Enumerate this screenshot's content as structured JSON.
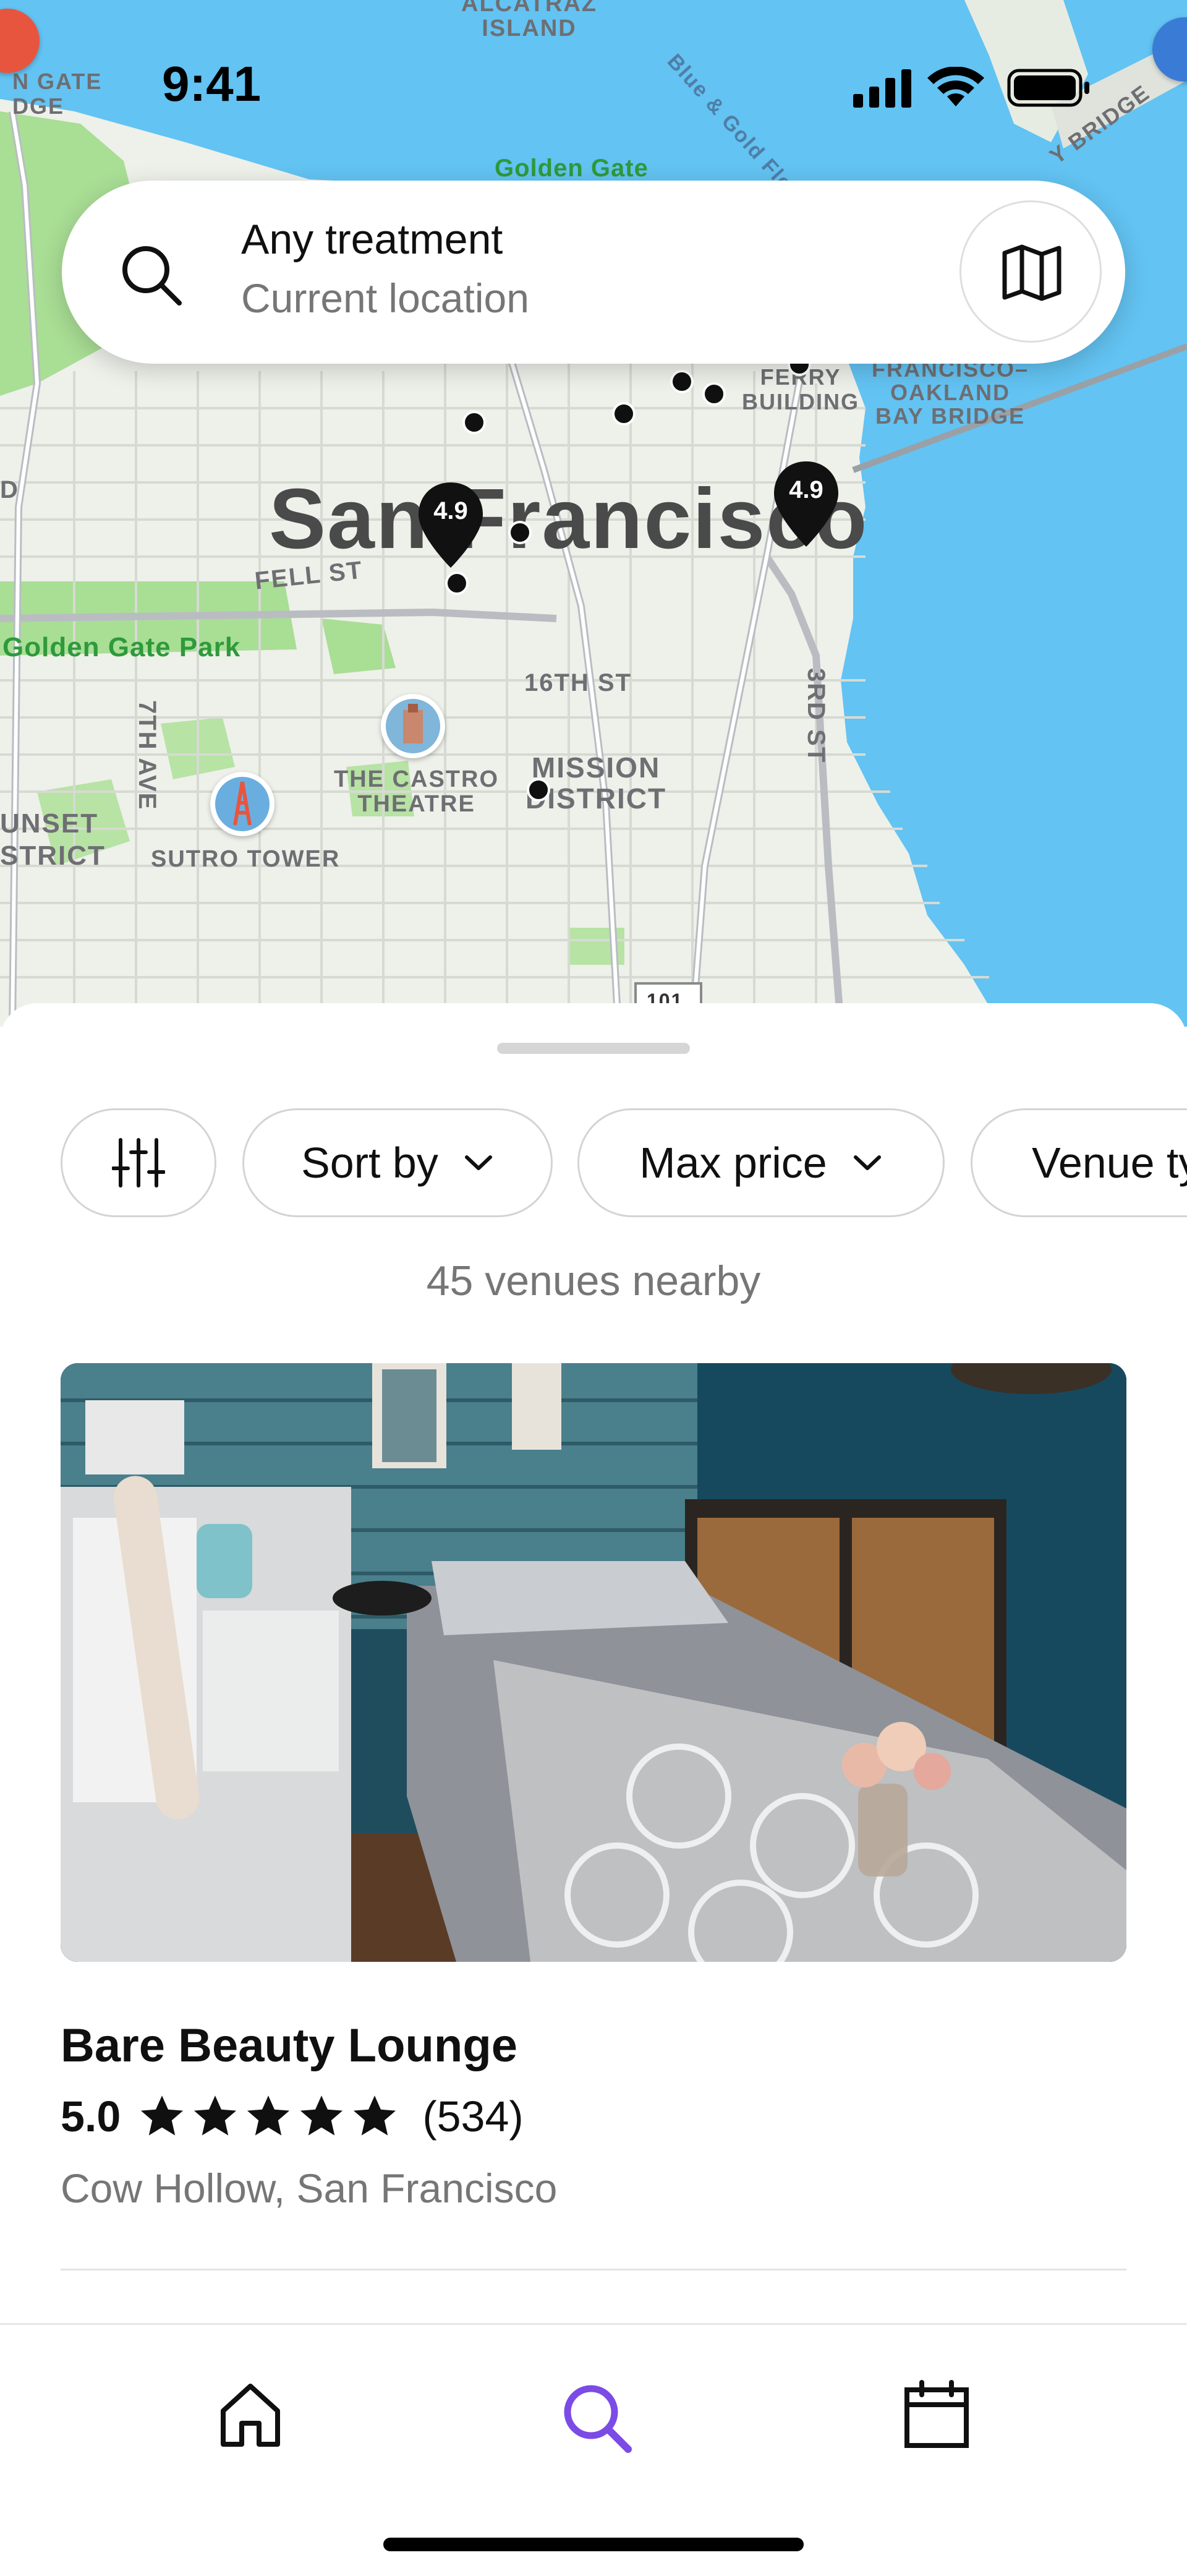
{
  "status_bar": {
    "time": "9:41"
  },
  "search": {
    "title": "Any treatment",
    "subtitle": "Current location"
  },
  "map": {
    "city_label": "San Francisco",
    "labels": {
      "alcatraz": "ALCATRAZ\nISLAND",
      "golden_gate": "Golden Gate",
      "ferry_building": "FERRY\nBUILDING",
      "bay_bridge": "FRANCISCO–\nOAKLAND\nBAY BRIDGE",
      "blue_gold_fleet": "Blue & Gold Fleet",
      "fell_st": "FELL ST",
      "golden_gate_park": "Golden Gate Park",
      "sixteenth_st": "16TH ST",
      "third_st": "3RD ST",
      "seventh_ave": "7TH AVE",
      "castro": "THE CASTRO\nTHEATRE",
      "mission": "MISSION\nDISTRICT",
      "sutro": "SUTRO TOWER",
      "sunset": "UNSET\nSTRICT",
      "gate_bridge_edge": "N GATE\nDGE",
      "bay_bridge_edge": "Y BRIDGE",
      "highway": "101",
      "left_edge": "D"
    },
    "pins": [
      {
        "rating": "4.9"
      },
      {
        "rating": "4.9"
      }
    ]
  },
  "filters": {
    "sort_by": "Sort by",
    "max_price": "Max price",
    "venue_type": "Venue type"
  },
  "results": {
    "count_text": "45 venues nearby"
  },
  "venue": {
    "name": "Bare Beauty Lounge",
    "rating": "5.0",
    "stars": 5,
    "review_count": "(534)",
    "location": "Cow Hollow, San Francisco"
  },
  "colors": {
    "accent": "#7B4BE6",
    "water": "#63C3F2",
    "park": "#A9DE95"
  },
  "tab_bar": {
    "tabs": [
      "home-icon",
      "search-icon",
      "calendar-icon"
    ],
    "active": "search-icon"
  }
}
